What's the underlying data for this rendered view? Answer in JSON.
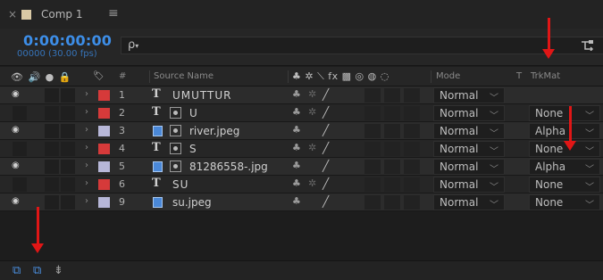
{
  "tab": {
    "close": "×",
    "title": "Comp 1",
    "menu": "≡",
    "swatch_color": "#d9c9a5"
  },
  "header": {
    "timecode": "0:00:00:00",
    "fps": "00000 (30.00 fps)",
    "search_icon": "ρ",
    "search_caret": "▾",
    "search_placeholder": ""
  },
  "columns": {
    "av_icons": "👁 🔊 ● 🔒",
    "label": "🏷",
    "num": "#",
    "source_name": "Source Name",
    "switch_icons": "♣ ✲ ⟍ fx ▩ ◎ ◍ ◌",
    "mode": "Mode",
    "t": "T",
    "trkmat": "TrkMat"
  },
  "layers": [
    {
      "num": "1",
      "type": "text",
      "name": "UMUTTUR",
      "visible": true,
      "label_color": "#d63a3a",
      "star": true,
      "mode": "Normal",
      "trkmat": ""
    },
    {
      "num": "2",
      "type": "text-mask",
      "name": "U",
      "visible": false,
      "label_color": "#d63a3a",
      "star": true,
      "mode": "Normal",
      "trkmat": "None"
    },
    {
      "num": "3",
      "type": "image-mask",
      "name": "river.jpeg",
      "visible": true,
      "label_color": "#b7b7d8",
      "star": false,
      "mode": "Normal",
      "trkmat": "Alpha"
    },
    {
      "num": "4",
      "type": "text-mask",
      "name": "S",
      "visible": false,
      "label_color": "#d63a3a",
      "star": true,
      "mode": "Normal",
      "trkmat": "None"
    },
    {
      "num": "5",
      "type": "image-mask",
      "name": "81286558-.jpg",
      "visible": true,
      "label_color": "#b7b7d8",
      "star": false,
      "mode": "Normal",
      "trkmat": "Alpha"
    },
    {
      "num": "6",
      "type": "text",
      "name": "SU",
      "visible": false,
      "label_color": "#d63a3a",
      "star": true,
      "mode": "Normal",
      "trkmat": "None"
    },
    {
      "num": "9",
      "type": "image",
      "name": "su.jpeg",
      "visible": true,
      "label_color": "#b7b7d8",
      "star": false,
      "mode": "Normal",
      "trkmat": "None"
    }
  ],
  "footer": {
    "icon_a": "⧉",
    "icon_b": "⧉",
    "icon_c": "⇟"
  },
  "accent_color": "#3d8ee8",
  "annotation_color": "#e01616"
}
